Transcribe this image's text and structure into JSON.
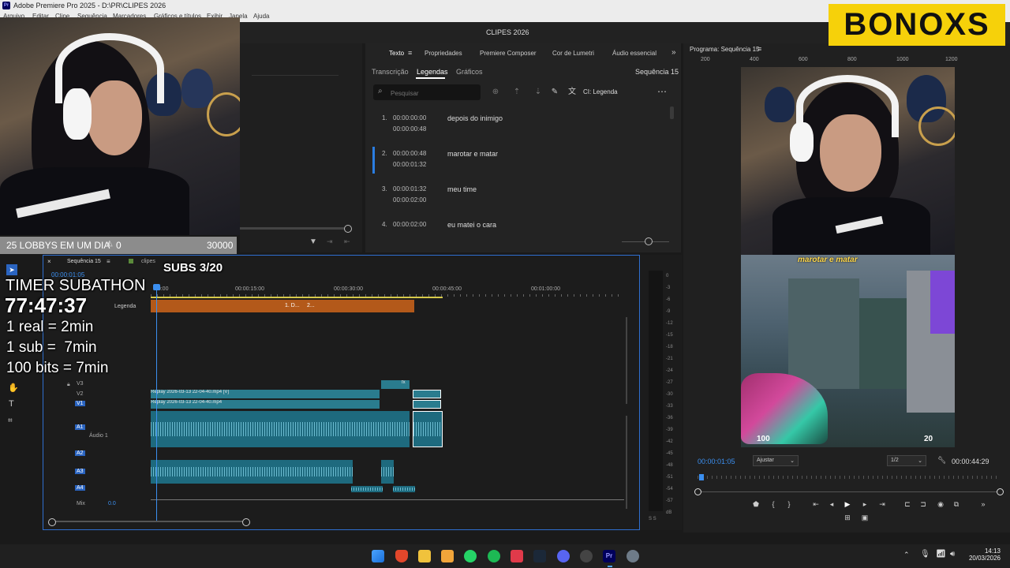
{
  "titlebar": {
    "title": "Adobe Premiere Pro 2025 - D:\\PR\\CLIPES 2026"
  },
  "menu": [
    "Arquivo",
    "Editar",
    "Clipe",
    "Sequência",
    "Marcadores",
    "Gráficos e títulos",
    "Exibir",
    "Janela",
    "Ajuda"
  ],
  "project": {
    "name": "CLIPES 2026"
  },
  "overlay": {
    "brand": "BONOXS",
    "lobby_label": "25 LOBBYS EM UM DIA",
    "lobby_count": "0",
    "lobby_goal": "30000",
    "subs": "SUBS 3/20",
    "timer_label": "TIMER SUBATHON",
    "timer_value": "77:47:37",
    "rule1": "1 real = 2min",
    "rule2": "1 sub =  7min",
    "rule3": "100 bits = 7min"
  },
  "captions_panel": {
    "tabs": [
      "Texto",
      "Propriedades",
      "Premiere Composer",
      "Cor de Lumetri",
      "Áudio essencial"
    ],
    "active_tab": "Texto",
    "subtabs": [
      "Transcrição",
      "Legendas",
      "Gráficos"
    ],
    "active_subtab": "Legendas",
    "sequence": "Sequência 15",
    "search_placeholder": "Pesquisar",
    "track_label": "CI: Legenda",
    "items": [
      {
        "n": "1.",
        "start": "00:00:00:00",
        "end": "00:00:00:48",
        "text": "depois do inimigo"
      },
      {
        "n": "2.",
        "start": "00:00:00:48",
        "end": "00:00:01:32",
        "text": "marotar e matar"
      },
      {
        "n": "3.",
        "start": "00:00:01:32",
        "end": "00:00:02:00",
        "text": "meu time"
      },
      {
        "n": "4.",
        "start": "00:00:02:00",
        "end": "",
        "text": "eu matei o cara"
      }
    ]
  },
  "timeline": {
    "tab_sequence": "Sequência 15",
    "tab_bin": "clipes",
    "timecode": "00:00:01:05",
    "ruler": [
      ":00:00",
      "00:00:15:00",
      "00:00:30:00",
      "00:00:45:00",
      "00:01:00:00"
    ],
    "caption_track": "Legenda",
    "caption_clips": [
      "1. D...",
      "2..."
    ],
    "tracks": [
      "V3",
      "V2",
      "V1",
      "A1",
      "A2",
      "A3",
      "A4"
    ],
    "audio1_name": "Áudio 1",
    "mix_label": "Mix",
    "mix_value": "0.0",
    "clip_v2": "Replay 2026-03-13 22-04-40.mp4 [V]",
    "clip_v1": "Replay 2026-03-13 22-04-40.mp4",
    "fx": "fx"
  },
  "meters": {
    "scale": [
      "0",
      "-3",
      "-6",
      "-9",
      "-12",
      "-15",
      "-18",
      "-21",
      "-24",
      "-27",
      "-30",
      "-33",
      "-36",
      "-39",
      "-42",
      "-45",
      "-48",
      "-51",
      "-54",
      "-57",
      "dB"
    ],
    "bottom": "S  S"
  },
  "program": {
    "title": "Programa: Sequência 15",
    "ruler": [
      "200",
      "400",
      "600",
      "800",
      "1000",
      "1200"
    ],
    "caption_overlay": "marotar e matar",
    "timecode": "00:00:01:05",
    "fit": "Ajustar",
    "resolution": "1/2",
    "duration": "00:00:44:29",
    "hud_left": "100",
    "hud_right": "20"
  },
  "taskbar": {
    "time": "14:13",
    "date": "20/03/2026"
  },
  "colors": {
    "accent": "#2a7de1",
    "brand_bg": "#f6d10a",
    "clip": "#2a7c8e",
    "caption_track": "#b3591a"
  }
}
